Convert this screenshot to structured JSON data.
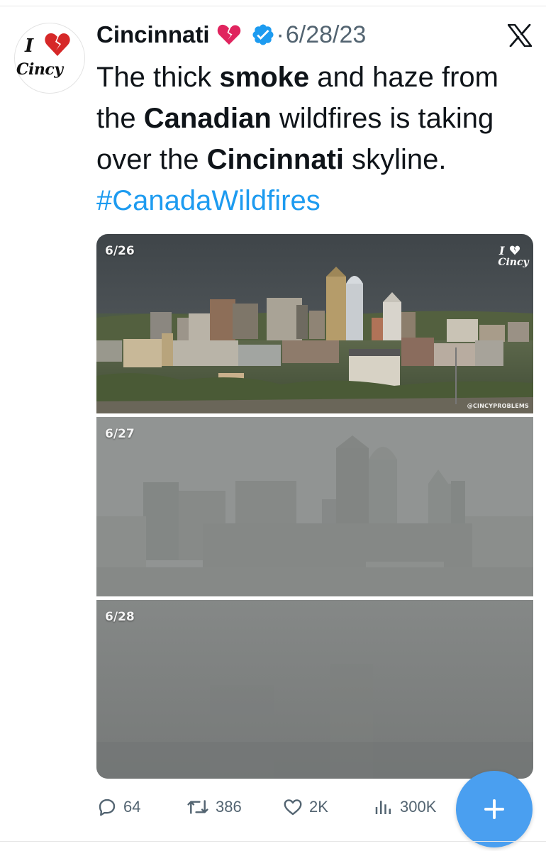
{
  "tweet": {
    "author": {
      "display_name": "Cincinnati",
      "name_emoji": "broken-heart-icon",
      "verified": true,
      "avatar": {
        "prefix": "I",
        "word": "Cincy",
        "icon": "broken-heart-icon"
      }
    },
    "separator": "·",
    "date": "6/28/23",
    "text": {
      "part1": "The thick ",
      "bold1": "smoke",
      "part2": " and haze from the ",
      "bold2": "Canadian",
      "part3": " wildfires is taking over the ",
      "bold3": "Cincinnati",
      "part4": " skyline. ",
      "hashtag": "#CanadaWildfires"
    },
    "media": {
      "panels": [
        {
          "label": "6/26",
          "credit": "@CINCYPROBLEMS",
          "watermark_prefix": "I",
          "watermark_word": "Cincy"
        },
        {
          "label": "6/27"
        },
        {
          "label": "6/28"
        }
      ]
    },
    "actions": {
      "replies": "64",
      "retweets": "386",
      "likes": "2K",
      "views": "300K"
    }
  },
  "header": {
    "close_icon": "x-logo-icon"
  },
  "fab": {
    "icon": "plus-icon"
  },
  "colors": {
    "accent": "#1d9bf0",
    "fab": "#4a9ff0",
    "verified": "#1d9bf0",
    "text": "#0f1419",
    "muted": "#536471",
    "heart_red": "#d62828"
  }
}
